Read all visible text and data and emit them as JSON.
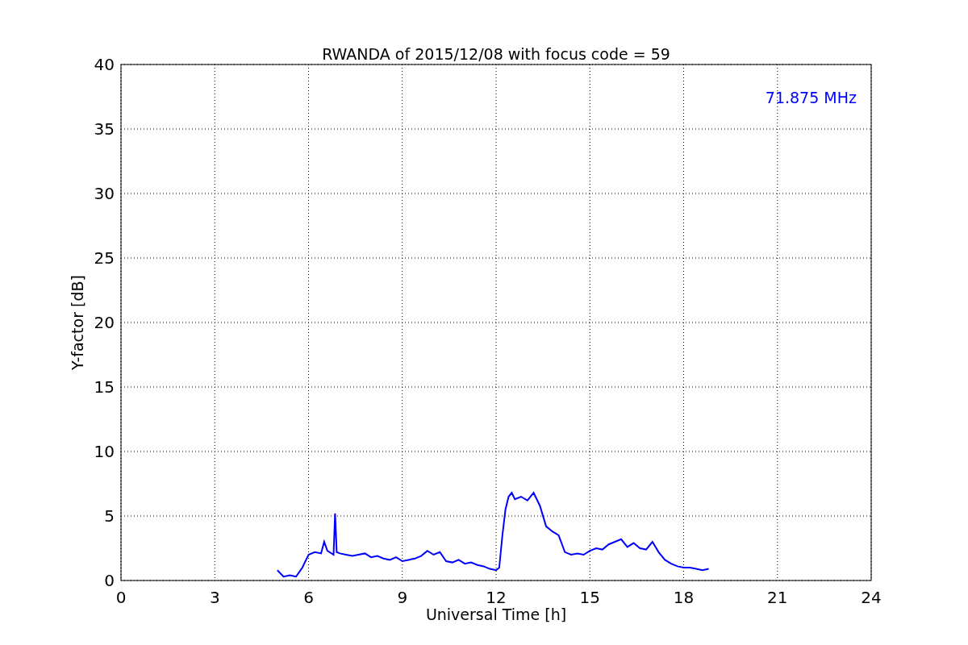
{
  "chart_data": {
    "type": "line",
    "title": "RWANDA of 2015/12/08 with focus code = 59",
    "xlabel": "Universal Time [h]",
    "ylabel": "Y-factor [dB]",
    "x": [
      5.0,
      5.2,
      5.4,
      5.6,
      5.8,
      6.0,
      6.2,
      6.4,
      6.5,
      6.6,
      6.8,
      6.85,
      6.9,
      7.0,
      7.2,
      7.4,
      7.6,
      7.8,
      8.0,
      8.2,
      8.4,
      8.6,
      8.8,
      9.0,
      9.2,
      9.4,
      9.6,
      9.8,
      10.0,
      10.2,
      10.4,
      10.6,
      10.8,
      11.0,
      11.2,
      11.4,
      11.6,
      11.8,
      12.0,
      12.1,
      12.2,
      12.3,
      12.4,
      12.5,
      12.6,
      12.8,
      13.0,
      13.2,
      13.4,
      13.6,
      13.8,
      14.0,
      14.2,
      14.4,
      14.6,
      14.8,
      15.0,
      15.2,
      15.4,
      15.6,
      15.8,
      16.0,
      16.2,
      16.4,
      16.6,
      16.8,
      17.0,
      17.2,
      17.4,
      17.6,
      17.8,
      18.0,
      18.2,
      18.4,
      18.6,
      18.8
    ],
    "series": [
      {
        "name": "71.875 MHz",
        "color": "#0000ff",
        "values": [
          0.8,
          0.3,
          0.4,
          0.3,
          1.0,
          2.0,
          2.2,
          2.1,
          3.0,
          2.3,
          2.0,
          5.2,
          2.2,
          2.1,
          2.0,
          1.9,
          2.0,
          2.1,
          1.8,
          1.9,
          1.7,
          1.6,
          1.8,
          1.5,
          1.6,
          1.7,
          1.9,
          2.3,
          2.0,
          2.2,
          1.5,
          1.4,
          1.6,
          1.3,
          1.4,
          1.2,
          1.1,
          0.9,
          0.8,
          1.0,
          3.5,
          5.5,
          6.5,
          6.8,
          6.3,
          6.5,
          6.2,
          6.8,
          5.8,
          4.2,
          3.8,
          3.5,
          2.2,
          2.0,
          2.1,
          2.0,
          2.3,
          2.5,
          2.4,
          2.8,
          3.0,
          3.2,
          2.6,
          2.9,
          2.5,
          2.4,
          3.0,
          2.2,
          1.6,
          1.3,
          1.1,
          1.0,
          1.0,
          0.9,
          0.8,
          0.9
        ]
      }
    ],
    "grid": true,
    "xlim": [
      0,
      24
    ],
    "ylim": [
      0,
      40
    ],
    "xticks": [
      0,
      3,
      6,
      9,
      12,
      15,
      18,
      21,
      24
    ],
    "yticks": [
      0,
      5,
      10,
      15,
      20,
      25,
      30,
      35,
      40
    ]
  }
}
